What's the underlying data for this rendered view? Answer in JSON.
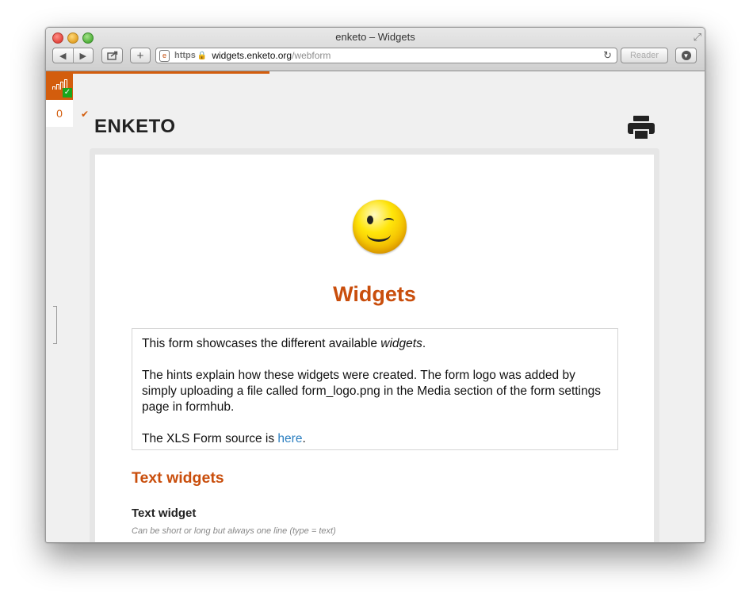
{
  "window": {
    "title": "enketo – Widgets"
  },
  "toolbar": {
    "back_icon": "◀",
    "forward_icon": "▶",
    "add_icon": "+",
    "url": {
      "scheme": "https",
      "host": "widgets.enketo.org",
      "path": "/webform"
    },
    "reader_label": "Reader"
  },
  "status": {
    "queue_count": "0"
  },
  "header": {
    "logo_text": "ENKETO"
  },
  "form": {
    "title": "Widgets",
    "intro": {
      "p1_pre": "This form showcases the different available ",
      "p1_em": "widgets",
      "p1_post": ".",
      "p2": "The hints explain how these widgets were created. The form logo was added by simply uploading a file called form_logo.png in the Media section of the form settings page in formhub.",
      "p3_pre": "The XLS Form source is ",
      "p3_link": "here",
      "p3_post": "."
    },
    "section_title": "Text widgets",
    "question": {
      "label": "Text widget",
      "hint": "Can be short or long but always one line (type = text)"
    }
  },
  "colors": {
    "accent": "#c94e0c",
    "link": "#2a7ec0",
    "online": "#19a51b"
  }
}
